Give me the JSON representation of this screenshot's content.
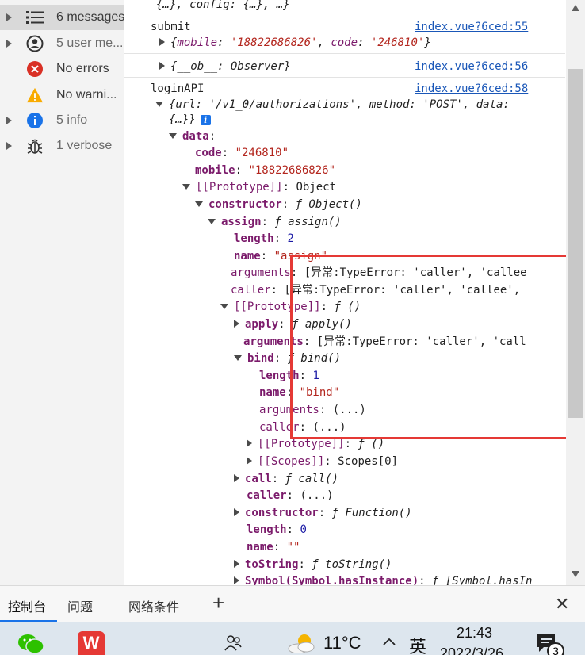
{
  "sidebar": {
    "items": [
      {
        "label": "6 messages"
      },
      {
        "label": "5 user me..."
      },
      {
        "label": "No errors"
      },
      {
        "label": "No warni..."
      },
      {
        "label": "5 info"
      },
      {
        "label": "1 verbose"
      }
    ]
  },
  "console": {
    "top_partial": "{…}, config: {…}, …}",
    "submit": {
      "label": "submit",
      "source": "index.vue?6ced:55",
      "obj_mobile_key": "mobile",
      "obj_mobile_val": "'18822686826'",
      "obj_code_key": "code",
      "obj_code_val": "'246810'"
    },
    "observer": {
      "text": "{__ob__: Observer}",
      "source": "index.vue?6ced:56"
    },
    "login": {
      "label": "loginAPI",
      "source": "index.vue?6ced:58",
      "summary_line1": "{url: '/v1_0/authorizations', method: 'POST', data:",
      "summary_line2": "{…}}",
      "info_badge": "i"
    },
    "tree": {
      "data_key": "data",
      "code_key": "code",
      "code_val": "\"246810\"",
      "mobile_key": "mobile",
      "mobile_val": "\"18822686826\"",
      "proto1": "[[Prototype]]",
      "proto1_val": "Object",
      "constructor_key": "constructor",
      "constructor_val": "ƒ Object()",
      "assign_key": "assign",
      "assign_val": "ƒ assign()",
      "length_key": "length",
      "length_val": "2",
      "name_key": "name",
      "name_val": "\"assign\"",
      "arguments_key": "arguments",
      "arguments_val": "[异常:TypeError: 'caller', 'callee",
      "caller_key": "caller",
      "caller_val": "[异常:TypeError: 'caller', 'callee',",
      "proto2": "[[Prototype]]",
      "proto2_val": "ƒ ()",
      "apply_key": "apply",
      "apply_val": "ƒ apply()",
      "arguments2_key": "arguments",
      "arguments2_val": "[异常:TypeError: 'caller', 'call",
      "bind_key": "bind",
      "bind_val": "ƒ bind()",
      "bind_length_key": "length",
      "bind_length_val": "1",
      "bind_name_key": "name",
      "bind_name_val": "\"bind\"",
      "bind_arguments_key": "arguments",
      "bind_arguments_val": "(...)",
      "bind_caller_key": "caller",
      "bind_caller_val": "(...)",
      "bind_proto": "[[Prototype]]",
      "bind_proto_val": "ƒ ()",
      "bind_scopes": "[[Scopes]]",
      "bind_scopes_val": "Scopes[0]",
      "call_key": "call",
      "call_val": "ƒ call()",
      "caller2_key": "caller",
      "caller2_val": "(...)",
      "constructor2_key": "constructor",
      "constructor2_val": "ƒ Function()",
      "length2_key": "length",
      "length2_val": "0",
      "name2_key": "name",
      "name2_val": "\"\"",
      "tostring_key": "toString",
      "tostring_val": "ƒ toString()",
      "symbol_key": "Symbol(Symbol.hasInstance)",
      "symbol_val": "ƒ [Symbol.hasIn"
    }
  },
  "bottom_tabs": {
    "console": "控制台",
    "issues": "问题",
    "network": "网络条件",
    "add": "+",
    "close": "✕"
  },
  "taskbar": {
    "temperature": "11°C",
    "ime": "英",
    "time": "21:43",
    "date": "2022/3/26",
    "notification_count": "3",
    "wps_label": "W"
  },
  "colors": {
    "highlight_box": "#e53935",
    "link": "#1a57b8",
    "key": "#7b1b6b",
    "string": "#b3261e",
    "number": "#1b1aa5"
  }
}
